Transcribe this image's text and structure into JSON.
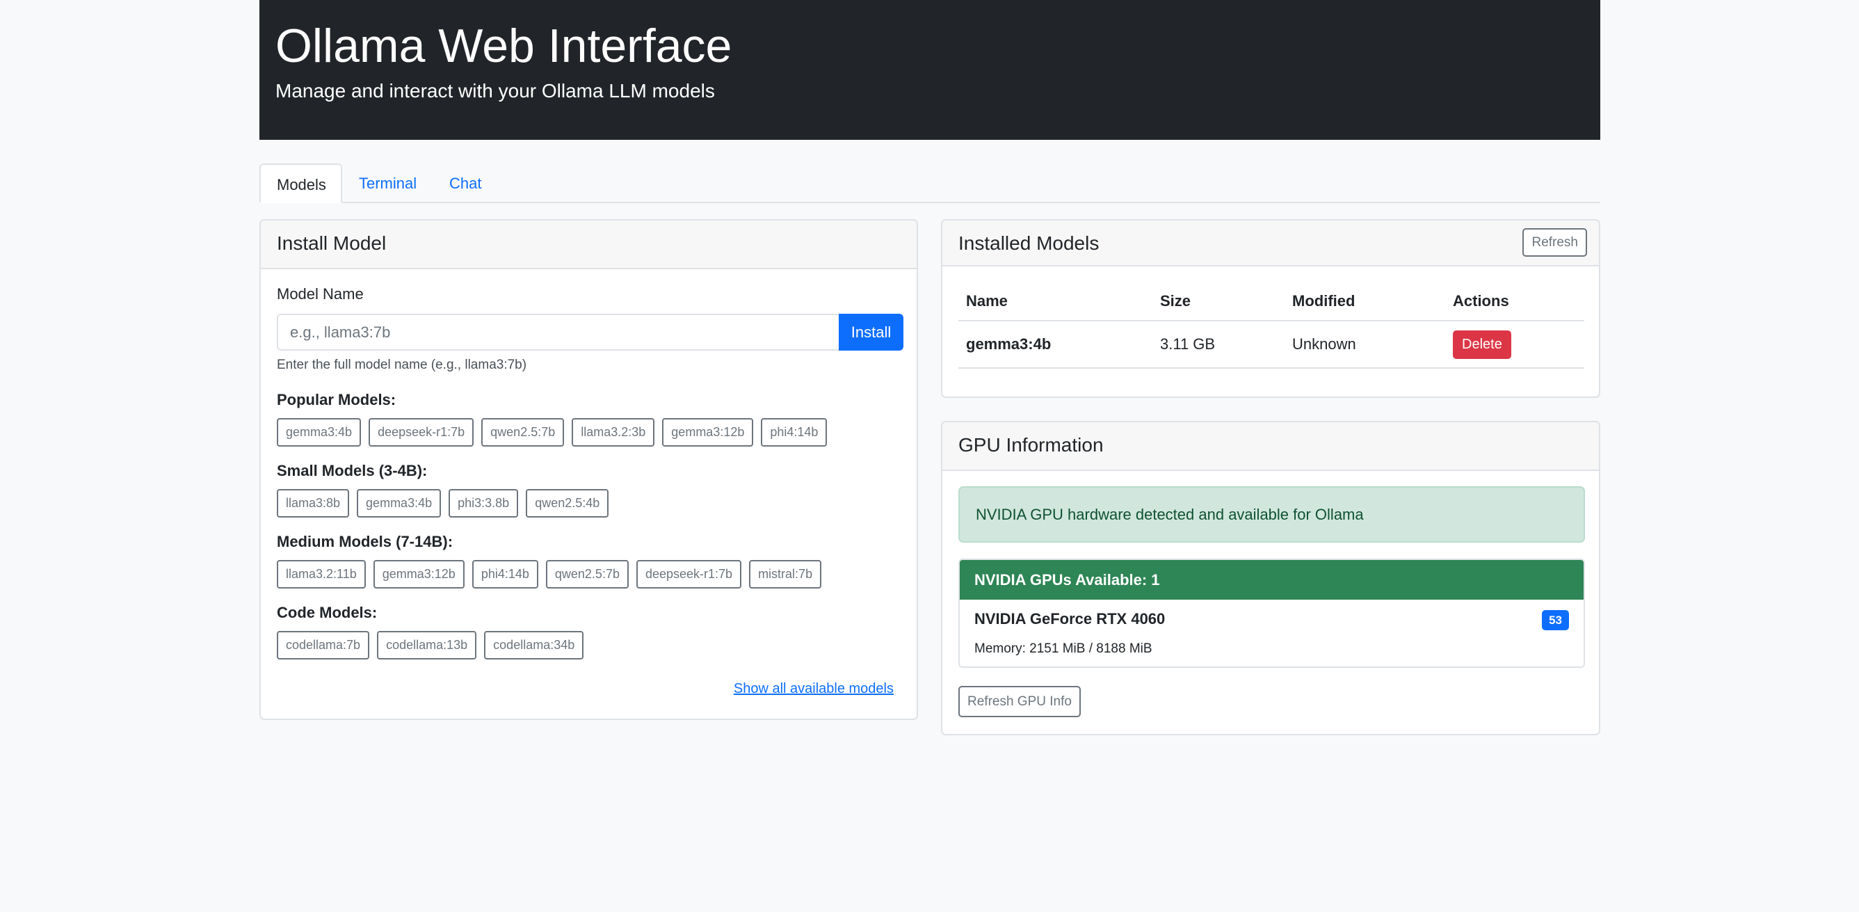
{
  "header": {
    "title": "Ollama Web Interface",
    "subtitle": "Manage and interact with your Ollama LLM models"
  },
  "tabs": [
    {
      "label": "Models",
      "active": true
    },
    {
      "label": "Terminal",
      "active": false
    },
    {
      "label": "Chat",
      "active": false
    }
  ],
  "install": {
    "title": "Install Model",
    "field_label": "Model Name",
    "placeholder": "e.g., llama3:7b",
    "install_label": "Install",
    "help": "Enter the full model name (e.g., llama3:7b)",
    "groups": [
      {
        "title": "Popular Models:",
        "models": [
          "gemma3:4b",
          "deepseek-r1:7b",
          "qwen2.5:7b",
          "llama3.2:3b",
          "gemma3:12b",
          "phi4:14b"
        ]
      },
      {
        "title": "Small Models (3-4B):",
        "models": [
          "llama3:8b",
          "gemma3:4b",
          "phi3:3.8b",
          "qwen2.5:4b"
        ]
      },
      {
        "title": "Medium Models (7-14B):",
        "models": [
          "llama3.2:11b",
          "gemma3:12b",
          "phi4:14b",
          "qwen2.5:7b",
          "deepseek-r1:7b",
          "mistral:7b"
        ]
      },
      {
        "title": "Code Models:",
        "models": [
          "codellama:7b",
          "codellama:13b",
          "codellama:34b"
        ]
      }
    ],
    "show_all": "Show all available models"
  },
  "installed": {
    "title": "Installed Models",
    "refresh_label": "Refresh",
    "columns": [
      "Name",
      "Size",
      "Modified",
      "Actions"
    ],
    "rows": [
      {
        "name": "gemma3:4b",
        "size": "3.11 GB",
        "modified": "Unknown",
        "action": "Delete"
      }
    ]
  },
  "gpu": {
    "title": "GPU Information",
    "alert": "NVIDIA GPU hardware detected and available for Ollama",
    "available": "NVIDIA GPUs Available: 1",
    "device_name": "NVIDIA GeForce RTX 4060",
    "badge": "53",
    "memory": "Memory: 2151 MiB / 8188 MiB",
    "refresh_label": "Refresh GPU Info"
  },
  "colors": {
    "primary": "#0d6efd",
    "danger": "#dc3545",
    "success_header": "#2e8555",
    "alert_bg": "#d1e7dd",
    "header_bg": "#212529"
  }
}
